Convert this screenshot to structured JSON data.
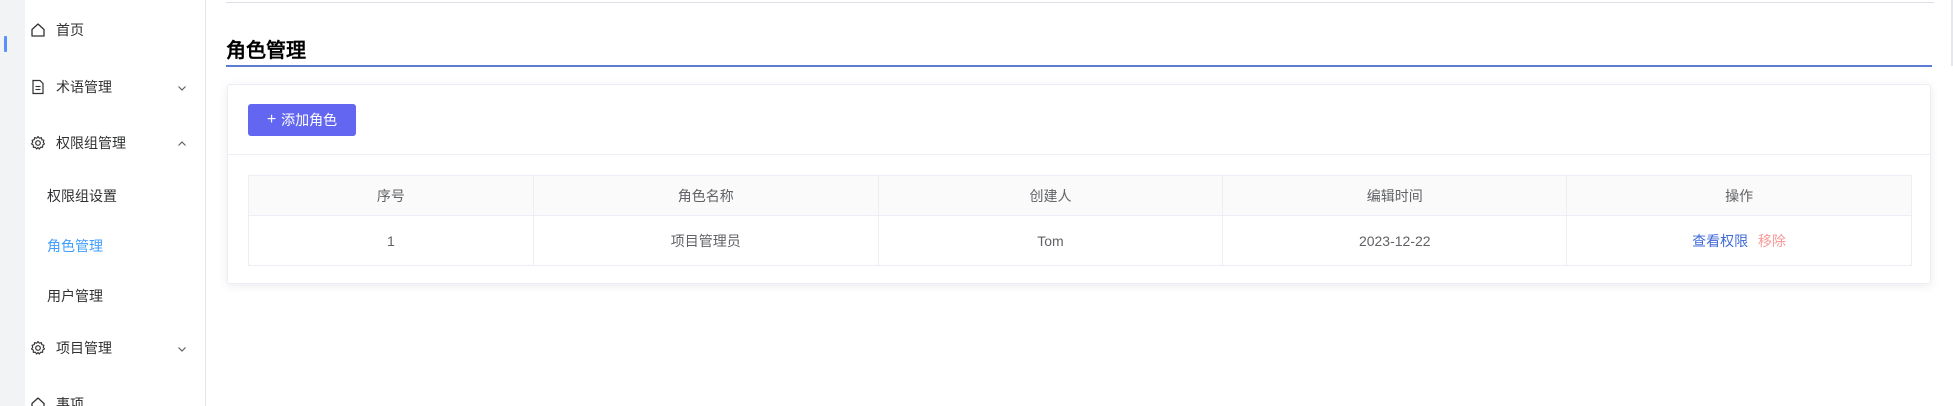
{
  "sidebar": {
    "home": "首页",
    "terms": "术语管理",
    "perm_group": "权限组管理",
    "perm_group_settings": "权限组设置",
    "role_management": "角色管理",
    "user_management": "用户管理",
    "project_management": "项目管理",
    "partial_item": "事项"
  },
  "main": {
    "title": "角色管理",
    "add_button": "添加角色"
  },
  "table": {
    "headers": [
      "序号",
      "角色名称",
      "创建人",
      "编辑时间",
      "操作"
    ],
    "rows": [
      {
        "index": "1",
        "role_name": "项目管理员",
        "creator": "Tom",
        "edit_time": "2023-12-22",
        "action_view": "查看权限",
        "action_remove": "移除"
      }
    ]
  },
  "colors": {
    "primary_button": "#6366f1",
    "active_menu": "#409eff",
    "link": "#3f6ad8",
    "danger_link": "#f89898",
    "title_underline": "#5b7bd5"
  },
  "icons": {
    "home": "home-icon",
    "terms": "document-icon",
    "perm_group": "gear-icon",
    "project": "gear-icon",
    "add": "plus-icon"
  }
}
